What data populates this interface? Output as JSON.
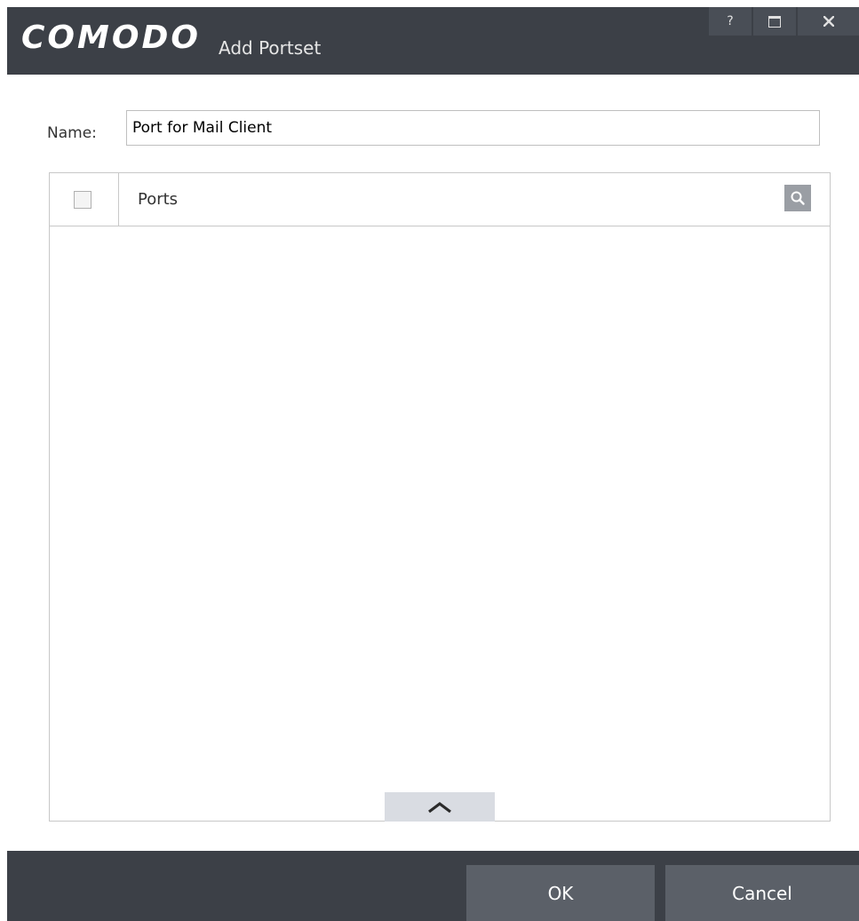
{
  "window": {
    "brand": "COMODO",
    "title": "Add Portset",
    "controls": {
      "help": "?"
    }
  },
  "form": {
    "name_label": "Name:",
    "name_value": "Port for Mail Client"
  },
  "table": {
    "columns": [
      "Ports"
    ],
    "rows": []
  },
  "footer": {
    "ok_label": "OK",
    "cancel_label": "Cancel"
  },
  "icons": {
    "search": "search-icon",
    "collapse": "chevron-up-icon",
    "maximize": "maximize-icon",
    "close": "close-icon"
  }
}
